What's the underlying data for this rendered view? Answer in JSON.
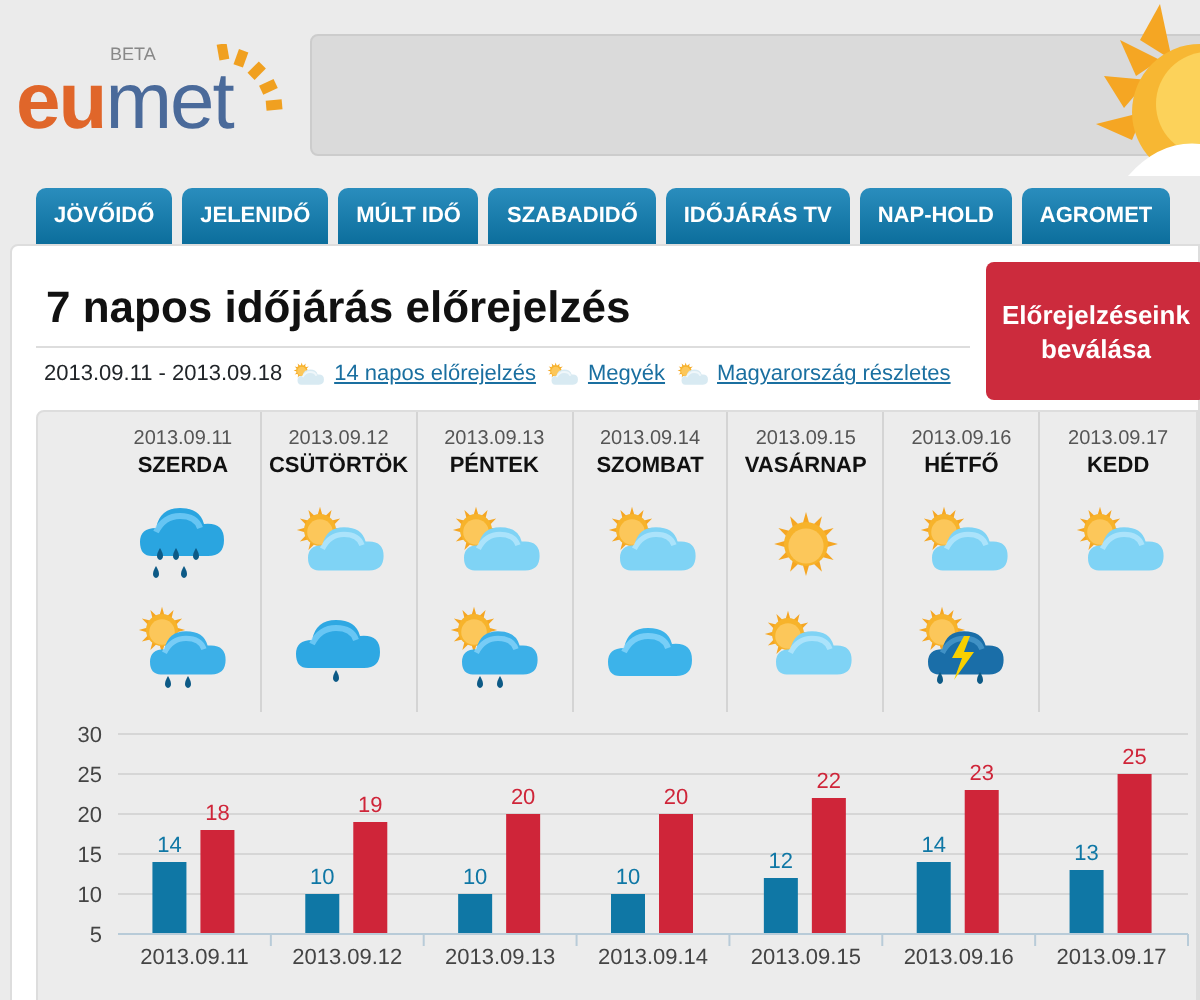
{
  "logo": {
    "first": "eu",
    "second": "met",
    "badge": "BETA"
  },
  "nav": [
    {
      "label": "JÖVŐIDŐ"
    },
    {
      "label": "JELENIDŐ"
    },
    {
      "label": "MÚLT IDŐ"
    },
    {
      "label": "SZABADIDŐ"
    },
    {
      "label": "IDŐJÁRÁS TV"
    },
    {
      "label": "NAP-HOLD"
    },
    {
      "label": "AGROMET"
    }
  ],
  "title": "7 napos időjárás előrejelzés",
  "accuracy_button": "Előrejelzéseink beválása",
  "date_range": "2013.09.11 - 2013.09.18",
  "links": [
    {
      "label": "14 napos előrejelzés"
    },
    {
      "label": "Megyék"
    },
    {
      "label": "Magyarország részletes"
    }
  ],
  "days": [
    {
      "date": "2013.09.11",
      "name": "SZERDA",
      "icons": [
        {
          "kind": "rain"
        },
        {
          "kind": "partly-rain"
        }
      ]
    },
    {
      "date": "2013.09.12",
      "name": "CSÜTÖRTÖK",
      "icons": [
        {
          "kind": "partly"
        },
        {
          "kind": "cloud-drizzle"
        }
      ]
    },
    {
      "date": "2013.09.13",
      "name": "PÉNTEK",
      "icons": [
        {
          "kind": "partly"
        },
        {
          "kind": "partly-rain"
        }
      ]
    },
    {
      "date": "2013.09.14",
      "name": "SZOMBAT",
      "icons": [
        {
          "kind": "partly"
        },
        {
          "kind": "cloud"
        }
      ]
    },
    {
      "date": "2013.09.15",
      "name": "VASÁRNAP",
      "icons": [
        {
          "kind": "sun"
        },
        {
          "kind": "partly"
        }
      ]
    },
    {
      "date": "2013.09.16",
      "name": "HÉTFŐ",
      "icons": [
        {
          "kind": "partly"
        },
        {
          "kind": "storm"
        }
      ]
    },
    {
      "date": "2013.09.17",
      "name": "KEDD",
      "icons": [
        {
          "kind": "partly"
        }
      ]
    }
  ],
  "chart_data": {
    "type": "bar",
    "categories": [
      "2013.09.11",
      "2013.09.12",
      "2013.09.13",
      "2013.09.14",
      "2013.09.15",
      "2013.09.16",
      "2013.09.17"
    ],
    "series": [
      {
        "color": "#0f77a5",
        "values": [
          14,
          10,
          10,
          10,
          12,
          14,
          13
        ]
      },
      {
        "color": "#cf2539",
        "values": [
          18,
          19,
          20,
          20,
          22,
          23,
          25
        ]
      }
    ],
    "ylim": [
      5,
      30
    ],
    "yticks": [
      5,
      10,
      15,
      20,
      25,
      30
    ],
    "data_labels": true,
    "grid": true
  }
}
